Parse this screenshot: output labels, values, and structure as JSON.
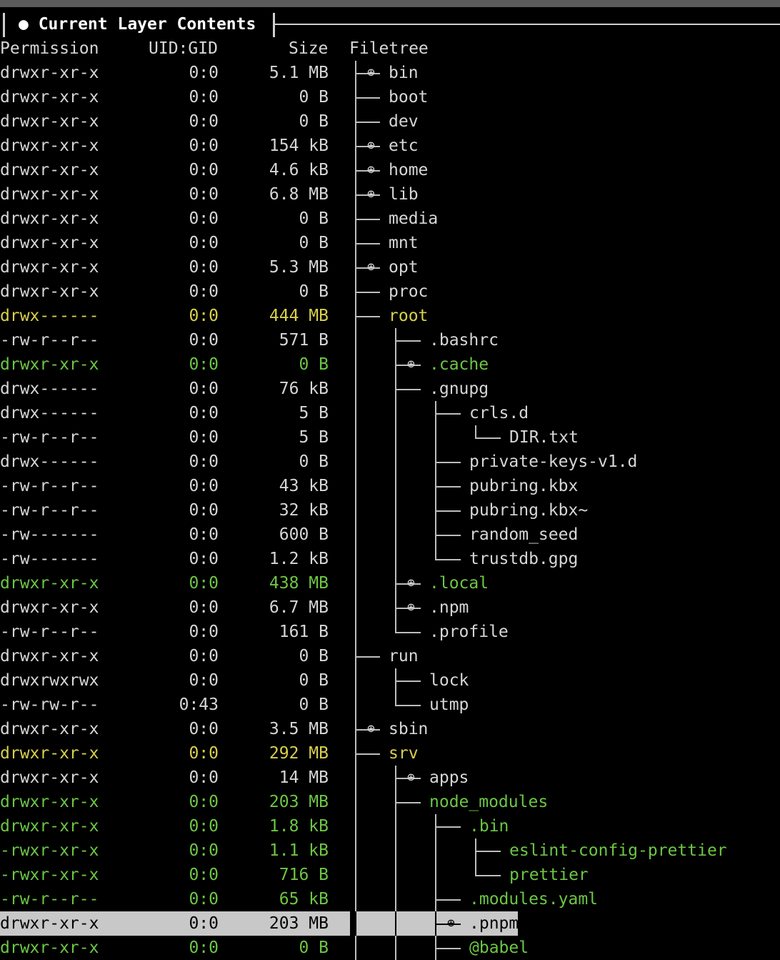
{
  "header": {
    "title": "● Current Layer Contents"
  },
  "columns": {
    "permission": "Permission",
    "uidgid": "UID:GID",
    "size": "Size",
    "filetree": "Filetree"
  },
  "colors": {
    "background": "#000000",
    "text": "#d6d6d6",
    "green": "#6cc644",
    "yellow": "#d8d04c",
    "selection": "#c8c8c8"
  },
  "rows": [
    {
      "perm": "drwxr-xr-x",
      "uid": "0:0",
      "size": "5.1 MB",
      "name": "bin",
      "depth": 0,
      "expand": true,
      "last": false,
      "color": "normal"
    },
    {
      "perm": "drwxr-xr-x",
      "uid": "0:0",
      "size": "0 B",
      "name": "boot",
      "depth": 0,
      "expand": false,
      "last": false,
      "color": "normal"
    },
    {
      "perm": "drwxr-xr-x",
      "uid": "0:0",
      "size": "0 B",
      "name": "dev",
      "depth": 0,
      "expand": false,
      "last": false,
      "color": "normal"
    },
    {
      "perm": "drwxr-xr-x",
      "uid": "0:0",
      "size": "154 kB",
      "name": "etc",
      "depth": 0,
      "expand": true,
      "last": false,
      "color": "normal"
    },
    {
      "perm": "drwxr-xr-x",
      "uid": "0:0",
      "size": "4.6 kB",
      "name": "home",
      "depth": 0,
      "expand": true,
      "last": false,
      "color": "normal"
    },
    {
      "perm": "drwxr-xr-x",
      "uid": "0:0",
      "size": "6.8 MB",
      "name": "lib",
      "depth": 0,
      "expand": true,
      "last": false,
      "color": "normal"
    },
    {
      "perm": "drwxr-xr-x",
      "uid": "0:0",
      "size": "0 B",
      "name": "media",
      "depth": 0,
      "expand": false,
      "last": false,
      "color": "normal"
    },
    {
      "perm": "drwxr-xr-x",
      "uid": "0:0",
      "size": "0 B",
      "name": "mnt",
      "depth": 0,
      "expand": false,
      "last": false,
      "color": "normal"
    },
    {
      "perm": "drwxr-xr-x",
      "uid": "0:0",
      "size": "5.3 MB",
      "name": "opt",
      "depth": 0,
      "expand": true,
      "last": false,
      "color": "normal"
    },
    {
      "perm": "drwxr-xr-x",
      "uid": "0:0",
      "size": "0 B",
      "name": "proc",
      "depth": 0,
      "expand": false,
      "last": false,
      "color": "normal"
    },
    {
      "perm": "drwx------",
      "uid": "0:0",
      "size": "444 MB",
      "name": "root",
      "depth": 0,
      "expand": false,
      "last": false,
      "color": "yellow"
    },
    {
      "perm": "-rw-r--r--",
      "uid": "0:0",
      "size": "571 B",
      "name": ".bashrc",
      "depth": 1,
      "expand": false,
      "last": false,
      "color": "normal"
    },
    {
      "perm": "drwxr-xr-x",
      "uid": "0:0",
      "size": "0 B",
      "name": ".cache",
      "depth": 1,
      "expand": true,
      "last": false,
      "color": "green"
    },
    {
      "perm": "drwx------",
      "uid": "0:0",
      "size": "76 kB",
      "name": ".gnupg",
      "depth": 1,
      "expand": false,
      "last": false,
      "color": "normal"
    },
    {
      "perm": "drwx------",
      "uid": "0:0",
      "size": "5 B",
      "name": "crls.d",
      "depth": 2,
      "expand": false,
      "last": false,
      "color": "normal"
    },
    {
      "perm": "-rw-r--r--",
      "uid": "0:0",
      "size": "5 B",
      "name": "DIR.txt",
      "depth": 3,
      "expand": false,
      "last": true,
      "color": "normal"
    },
    {
      "perm": "drwx------",
      "uid": "0:0",
      "size": "0 B",
      "name": "private-keys-v1.d",
      "depth": 2,
      "expand": false,
      "last": false,
      "color": "normal"
    },
    {
      "perm": "-rw-r--r--",
      "uid": "0:0",
      "size": "43 kB",
      "name": "pubring.kbx",
      "depth": 2,
      "expand": false,
      "last": false,
      "color": "normal"
    },
    {
      "perm": "-rw-r--r--",
      "uid": "0:0",
      "size": "32 kB",
      "name": "pubring.kbx~",
      "depth": 2,
      "expand": false,
      "last": false,
      "color": "normal"
    },
    {
      "perm": "-rw-------",
      "uid": "0:0",
      "size": "600 B",
      "name": "random_seed",
      "depth": 2,
      "expand": false,
      "last": false,
      "color": "normal"
    },
    {
      "perm": "-rw-------",
      "uid": "0:0",
      "size": "1.2 kB",
      "name": "trustdb.gpg",
      "depth": 2,
      "expand": false,
      "last": true,
      "color": "normal"
    },
    {
      "perm": "drwxr-xr-x",
      "uid": "0:0",
      "size": "438 MB",
      "name": ".local",
      "depth": 1,
      "expand": true,
      "last": false,
      "color": "green"
    },
    {
      "perm": "drwxr-xr-x",
      "uid": "0:0",
      "size": "6.7 MB",
      "name": ".npm",
      "depth": 1,
      "expand": true,
      "last": false,
      "color": "normal"
    },
    {
      "perm": "-rw-r--r--",
      "uid": "0:0",
      "size": "161 B",
      "name": ".profile",
      "depth": 1,
      "expand": false,
      "last": true,
      "color": "normal"
    },
    {
      "perm": "drwxr-xr-x",
      "uid": "0:0",
      "size": "0 B",
      "name": "run",
      "depth": 0,
      "expand": false,
      "last": false,
      "color": "normal"
    },
    {
      "perm": "drwxrwxrwx",
      "uid": "0:0",
      "size": "0 B",
      "name": "lock",
      "depth": 1,
      "expand": false,
      "last": false,
      "color": "normal"
    },
    {
      "perm": "-rw-rw-r--",
      "uid": "0:43",
      "size": "0 B",
      "name": "utmp",
      "depth": 1,
      "expand": false,
      "last": true,
      "color": "normal"
    },
    {
      "perm": "drwxr-xr-x",
      "uid": "0:0",
      "size": "3.5 MB",
      "name": "sbin",
      "depth": 0,
      "expand": true,
      "last": false,
      "color": "normal"
    },
    {
      "perm": "drwxr-xr-x",
      "uid": "0:0",
      "size": "292 MB",
      "name": "srv",
      "depth": 0,
      "expand": false,
      "last": false,
      "color": "yellow"
    },
    {
      "perm": "drwxr-xr-x",
      "uid": "0:0",
      "size": "14 MB",
      "name": "apps",
      "depth": 1,
      "expand": true,
      "last": false,
      "color": "normal"
    },
    {
      "perm": "drwxr-xr-x",
      "uid": "0:0",
      "size": "203 MB",
      "name": "node_modules",
      "depth": 1,
      "expand": false,
      "last": false,
      "color": "green"
    },
    {
      "perm": "drwxr-xr-x",
      "uid": "0:0",
      "size": "1.8 kB",
      "name": ".bin",
      "depth": 2,
      "expand": false,
      "last": false,
      "color": "green"
    },
    {
      "perm": "-rwxr-xr-x",
      "uid": "0:0",
      "size": "1.1 kB",
      "name": "eslint-config-prettier",
      "depth": 3,
      "expand": false,
      "last": false,
      "color": "green"
    },
    {
      "perm": "-rwxr-xr-x",
      "uid": "0:0",
      "size": "716 B",
      "name": "prettier",
      "depth": 3,
      "expand": false,
      "last": true,
      "color": "green"
    },
    {
      "perm": "-rw-r--r--",
      "uid": "0:0",
      "size": "65 kB",
      "name": ".modules.yaml",
      "depth": 2,
      "expand": false,
      "last": false,
      "color": "green"
    },
    {
      "perm": "drwxr-xr-x",
      "uid": "0:0",
      "size": "203 MB",
      "name": ".pnpm",
      "depth": 2,
      "expand": true,
      "last": false,
      "color": "selected"
    },
    {
      "perm": "drwxr-xr-x",
      "uid": "0:0",
      "size": "0 B",
      "name": "@babel",
      "depth": 2,
      "expand": false,
      "last": false,
      "color": "green"
    }
  ]
}
